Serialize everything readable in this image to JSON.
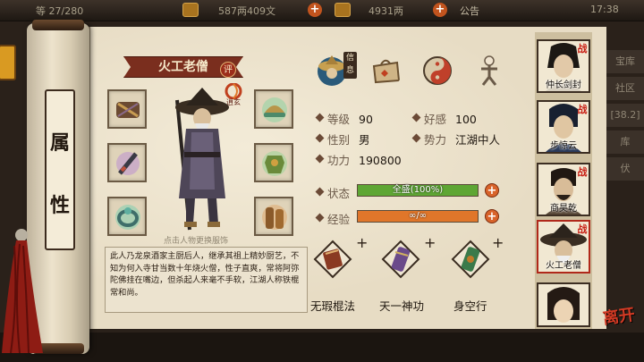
{
  "topbar": {
    "level_text": "等 27/280",
    "currency1": "587两409文",
    "currency2": "4931两",
    "notice": "公告",
    "clock": "17:38"
  },
  "side_roll": {
    "char1": "属",
    "char2": "性"
  },
  "hero": {
    "name": "火工老僧",
    "eval_badge": "评",
    "faction_mark": "逍玄",
    "hint": "点击人物更换服饰",
    "bio": "此人乃龙泉酒家主厨后人，继承其祖上精妙厨艺，不知为何入寺甘当数十年烧火僧，性子直爽，常将阿弥陀佛挂在嘴边，但杀起人来毫不手软，江湖人称铁棍常和尚。"
  },
  "tabs": [
    {
      "id": "info",
      "tag": "信息",
      "icon": "straw-hat-portrait-icon"
    },
    {
      "id": "bag",
      "icon": "bundle-icon"
    },
    {
      "id": "taiji",
      "icon": "yin-yang-icon"
    },
    {
      "id": "meridian",
      "icon": "body-figure-icon"
    }
  ],
  "attributes": {
    "level_label": "等级",
    "level_value": "90",
    "favor_label": "好感",
    "favor_value": "100",
    "gender_label": "性别",
    "gender_value": "男",
    "faction_label": "势力",
    "faction_value": "江湖中人",
    "power_label": "功力",
    "power_value": "190800"
  },
  "status": {
    "label": "状态",
    "text": "全盛(100%)",
    "fill": 1.0,
    "color": "#5ea634"
  },
  "exp": {
    "label": "经验",
    "text": "∞/∞",
    "fill": 1.0,
    "color": "#e0762a"
  },
  "skills": [
    {
      "name": "无瑕棍法",
      "icon": "scroll-book-icon"
    },
    {
      "name": "天一神功",
      "icon": "purple-scroll-icon"
    },
    {
      "name": "身空行",
      "icon": "green-scroll-icon"
    }
  ],
  "skill_plus": "+",
  "roster": [
    {
      "name": "仲长剑封",
      "tag": "战"
    },
    {
      "name": "步惊云",
      "tag": "战"
    },
    {
      "name": "商昊乾",
      "tag": "战"
    },
    {
      "name": "火工老僧",
      "tag": "战",
      "active": true
    },
    {
      "name": "",
      "tag": ""
    }
  ],
  "side_tabs": [
    "宝库",
    "社区",
    "[38.2]",
    "库",
    "伏"
  ],
  "leave_label": "离开",
  "colors": {
    "banner": "#7a2e1e",
    "parchment": "#e7dcc4",
    "accent": "#d8632a"
  }
}
